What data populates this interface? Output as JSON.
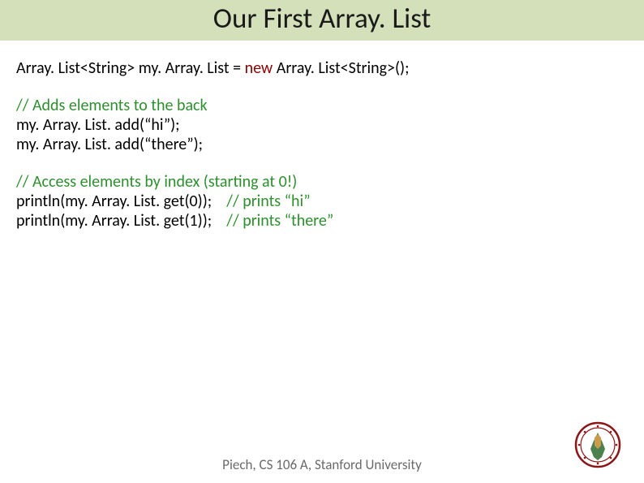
{
  "title": "Our First Array. List",
  "code": {
    "line1_decl": "Array. List<String> my. Array. List = ",
    "line1_new": "new",
    "line1_rest": " Array. List<String>();",
    "block1_comment": "// Adds elements to the back",
    "block1_l1": "my. Array. List. add(“hi”);",
    "block1_l2": "my. Array. List. add(“there”);",
    "block2_comment": "// Access elements by index (starting at 0!)",
    "block2_l1a": "println(my. Array. List. get(0));    ",
    "block2_l1b": "// prints “hi”",
    "block2_l2a": "println(my. Array. List. get(1));    ",
    "block2_l2b": "// prints “there”"
  },
  "footer": "Piech, CS 106 A, Stanford University",
  "seal_alt": "stanford-seal"
}
